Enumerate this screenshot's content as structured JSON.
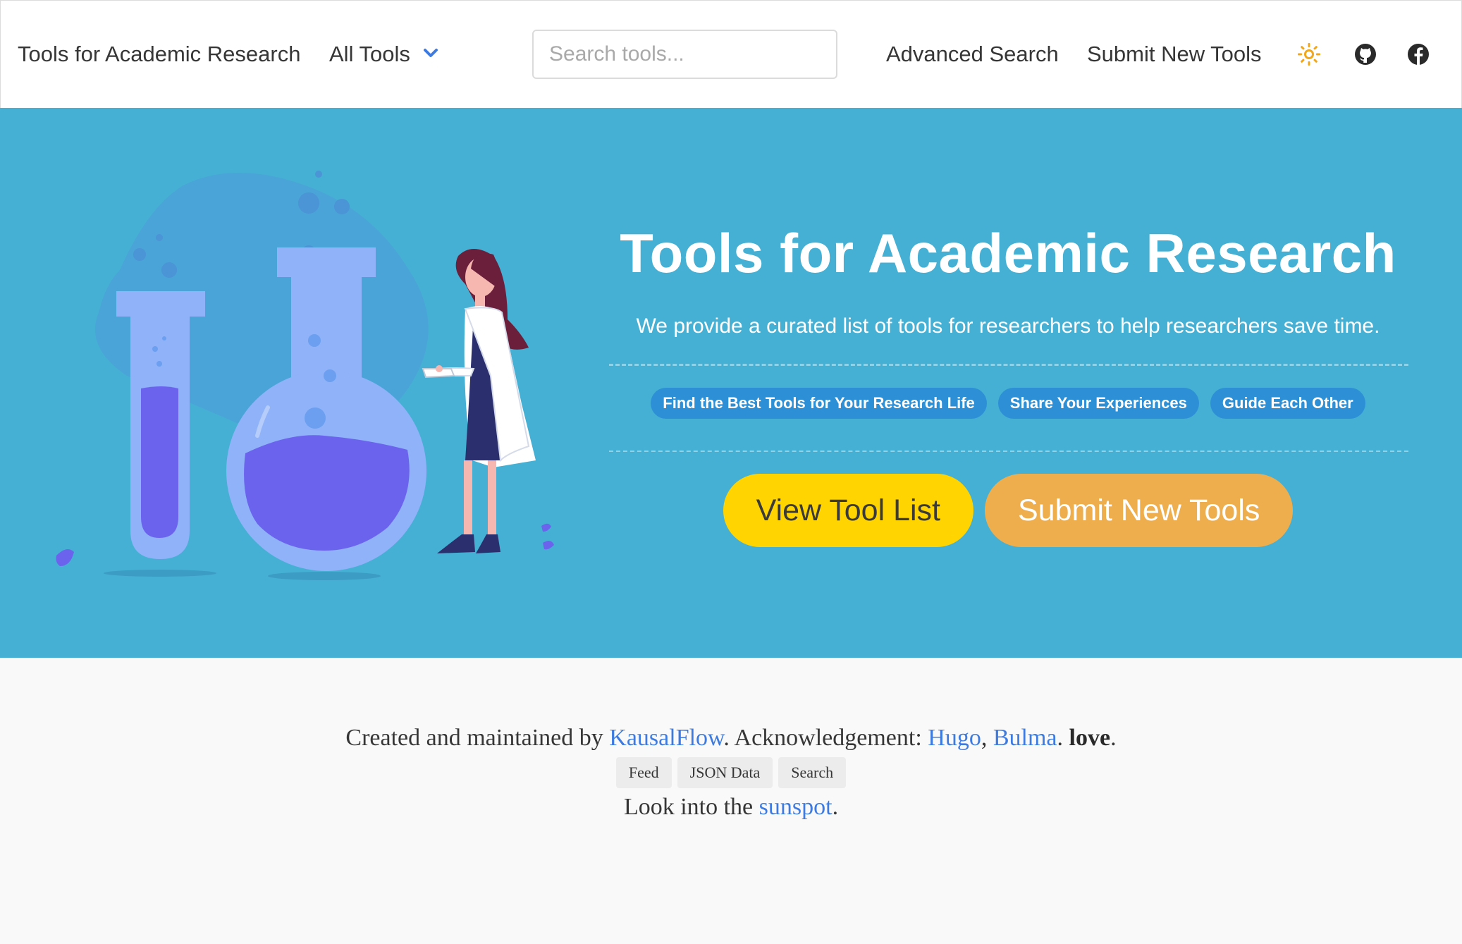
{
  "nav": {
    "brand": "Tools for Academic Research",
    "all_tools": "All Tools",
    "search_placeholder": "Search tools...",
    "advanced_search": "Advanced Search",
    "submit_new_tools": "Submit New Tools",
    "icons": [
      "sun-icon",
      "github-icon",
      "facebook-icon"
    ]
  },
  "hero": {
    "title": "Tools for Academic Research",
    "subtitle": "We provide a curated list of tools for researchers to help researchers save time.",
    "tags": [
      "Find the Best Tools for Your Research Life",
      "Share Your Experiences",
      "Guide Each Other"
    ],
    "view_button": "View Tool List",
    "submit_button": "Submit New Tools"
  },
  "footer": {
    "created_prefix": "Created and maintained by ",
    "author": "KausalFlow",
    "ack_text": ". Acknowledgement: ",
    "hugo": "Hugo",
    "comma": ", ",
    "bulma": "Bulma",
    "dot": ". ",
    "love": "love",
    "end": ".",
    "links": [
      "Feed",
      "JSON Data",
      "Search"
    ],
    "look_prefix": "Look into the ",
    "sunspot": "sunspot",
    "look_end": "."
  },
  "colors": {
    "hero_bg": "#45b0d4",
    "tag_bg": "#2d8fd6",
    "view_button": "#ffd400",
    "submit_button": "#efae4e",
    "link": "#3e7be0",
    "sun": "#f2a71b"
  }
}
